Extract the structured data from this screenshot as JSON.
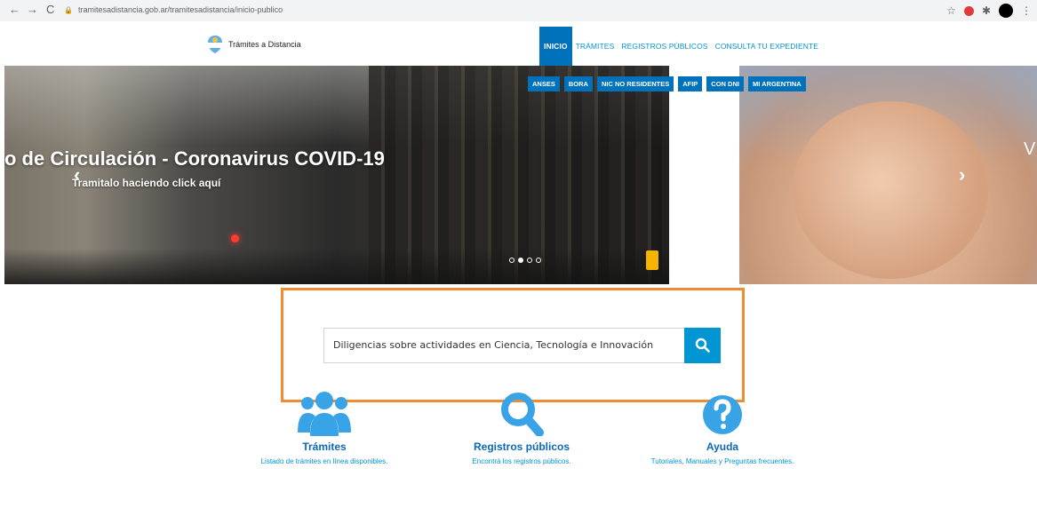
{
  "browser": {
    "url": "tramitesadistancia.gob.ar/tramitesadistancia/inicio-publico"
  },
  "header": {
    "logo_text": "Trámites a Distancia",
    "menu": [
      {
        "label": "INICIO",
        "active": true
      },
      {
        "label": "TRÁMITES",
        "active": false
      },
      {
        "label": "REGISTROS PÚBLICOS",
        "active": false
      },
      {
        "label": "CONSULTA TU EXPEDIENTE",
        "active": false
      }
    ]
  },
  "hero": {
    "title": "o de Circulación - Coronavirus COVID-19",
    "subtitle": "Tramitalo haciendo click aquí",
    "next_slide_fragment": "V",
    "quick_links": [
      "ANSES",
      "BORA",
      "NIC NO RESIDENTES",
      "AFIP",
      "CON DNI",
      "MI ARGENTINA"
    ],
    "active_dot": 1,
    "dot_count": 4
  },
  "search": {
    "value": "Diligencias sobre actividades en Ciencia, Tecnología e Innovación"
  },
  "features": [
    {
      "title": "Trámites",
      "desc": "Listado de trámites en línea disponibles.",
      "icon": "people-group-icon"
    },
    {
      "title": "Registros públicos",
      "desc": "Encontrá los registros públicos.",
      "icon": "magnifier-icon"
    },
    {
      "title": "Ayuda",
      "desc": "Tutoriales, Manuales y Preguntas frecuentes.",
      "icon": "question-icon"
    }
  ],
  "colors": {
    "primary": "#0072bb",
    "accent": "#0095d3",
    "highlight_frame": "#f08c33"
  }
}
